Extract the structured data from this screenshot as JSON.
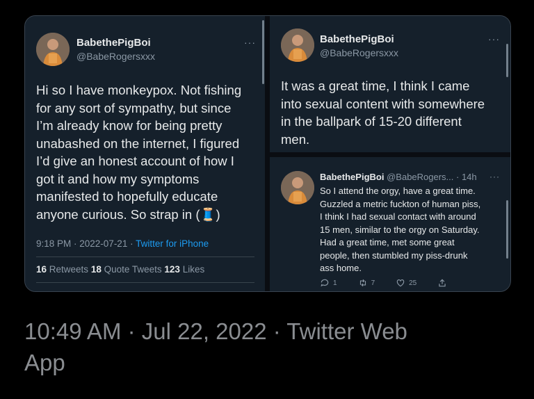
{
  "tweet_main": {
    "display_name": "BabethePigBoi",
    "handle": "@BabeRogersxxx",
    "more": "···",
    "lines": [
      "Hi so I have monkeypox. Not fishing",
      "for any sort of sympathy, but since",
      "I’m already know for being pretty",
      "unabashed on the internet, I figured",
      "I’d give an honest account of how I",
      "got it and how my symptoms",
      "manifested to hopefully educate",
      "anyone curious. So strap in (🧵)"
    ],
    "time": "9:18 PM · 2022-07-21 · ",
    "source": "Twitter for iPhone",
    "retweets_count": "16",
    "retweets_label": " Retweets ",
    "quotes_count": "18",
    "quotes_label": " Quote Tweets ",
    "likes_count": "123",
    "likes_label": " Likes"
  },
  "tweet_reply": {
    "display_name": "BabethePigBoi",
    "handle": "@BabeRogersxxx",
    "more": "···",
    "lines": [
      "It was a great time, I think I came",
      "into sexual content with somewhere",
      "in the ballpark of 15-20 different",
      "men."
    ]
  },
  "tweet_quoted": {
    "display_name": "BabethePigBoi",
    "handle_time": "@BabeRogers... · 14h",
    "more": "···",
    "lines": [
      "So I attend the orgy, have a great time.",
      "Guzzled a metric fuckton of human piss,",
      "I think I had sexual contact with around",
      "15 men, similar to the orgy on Saturday.",
      "Had a great time, met some great",
      "people, then stumbled my piss-drunk",
      "ass home."
    ],
    "reply_count": "1",
    "retweet_count": "7",
    "like_count": "25"
  },
  "footer": {
    "line1": "10:49 AM · Jul 22, 2022 · Twitter Web",
    "line2": "App"
  },
  "colors": {
    "background": "#15202b",
    "text": "#e7e9ea",
    "muted": "#8b98a5",
    "link": "#1d9bf0"
  }
}
